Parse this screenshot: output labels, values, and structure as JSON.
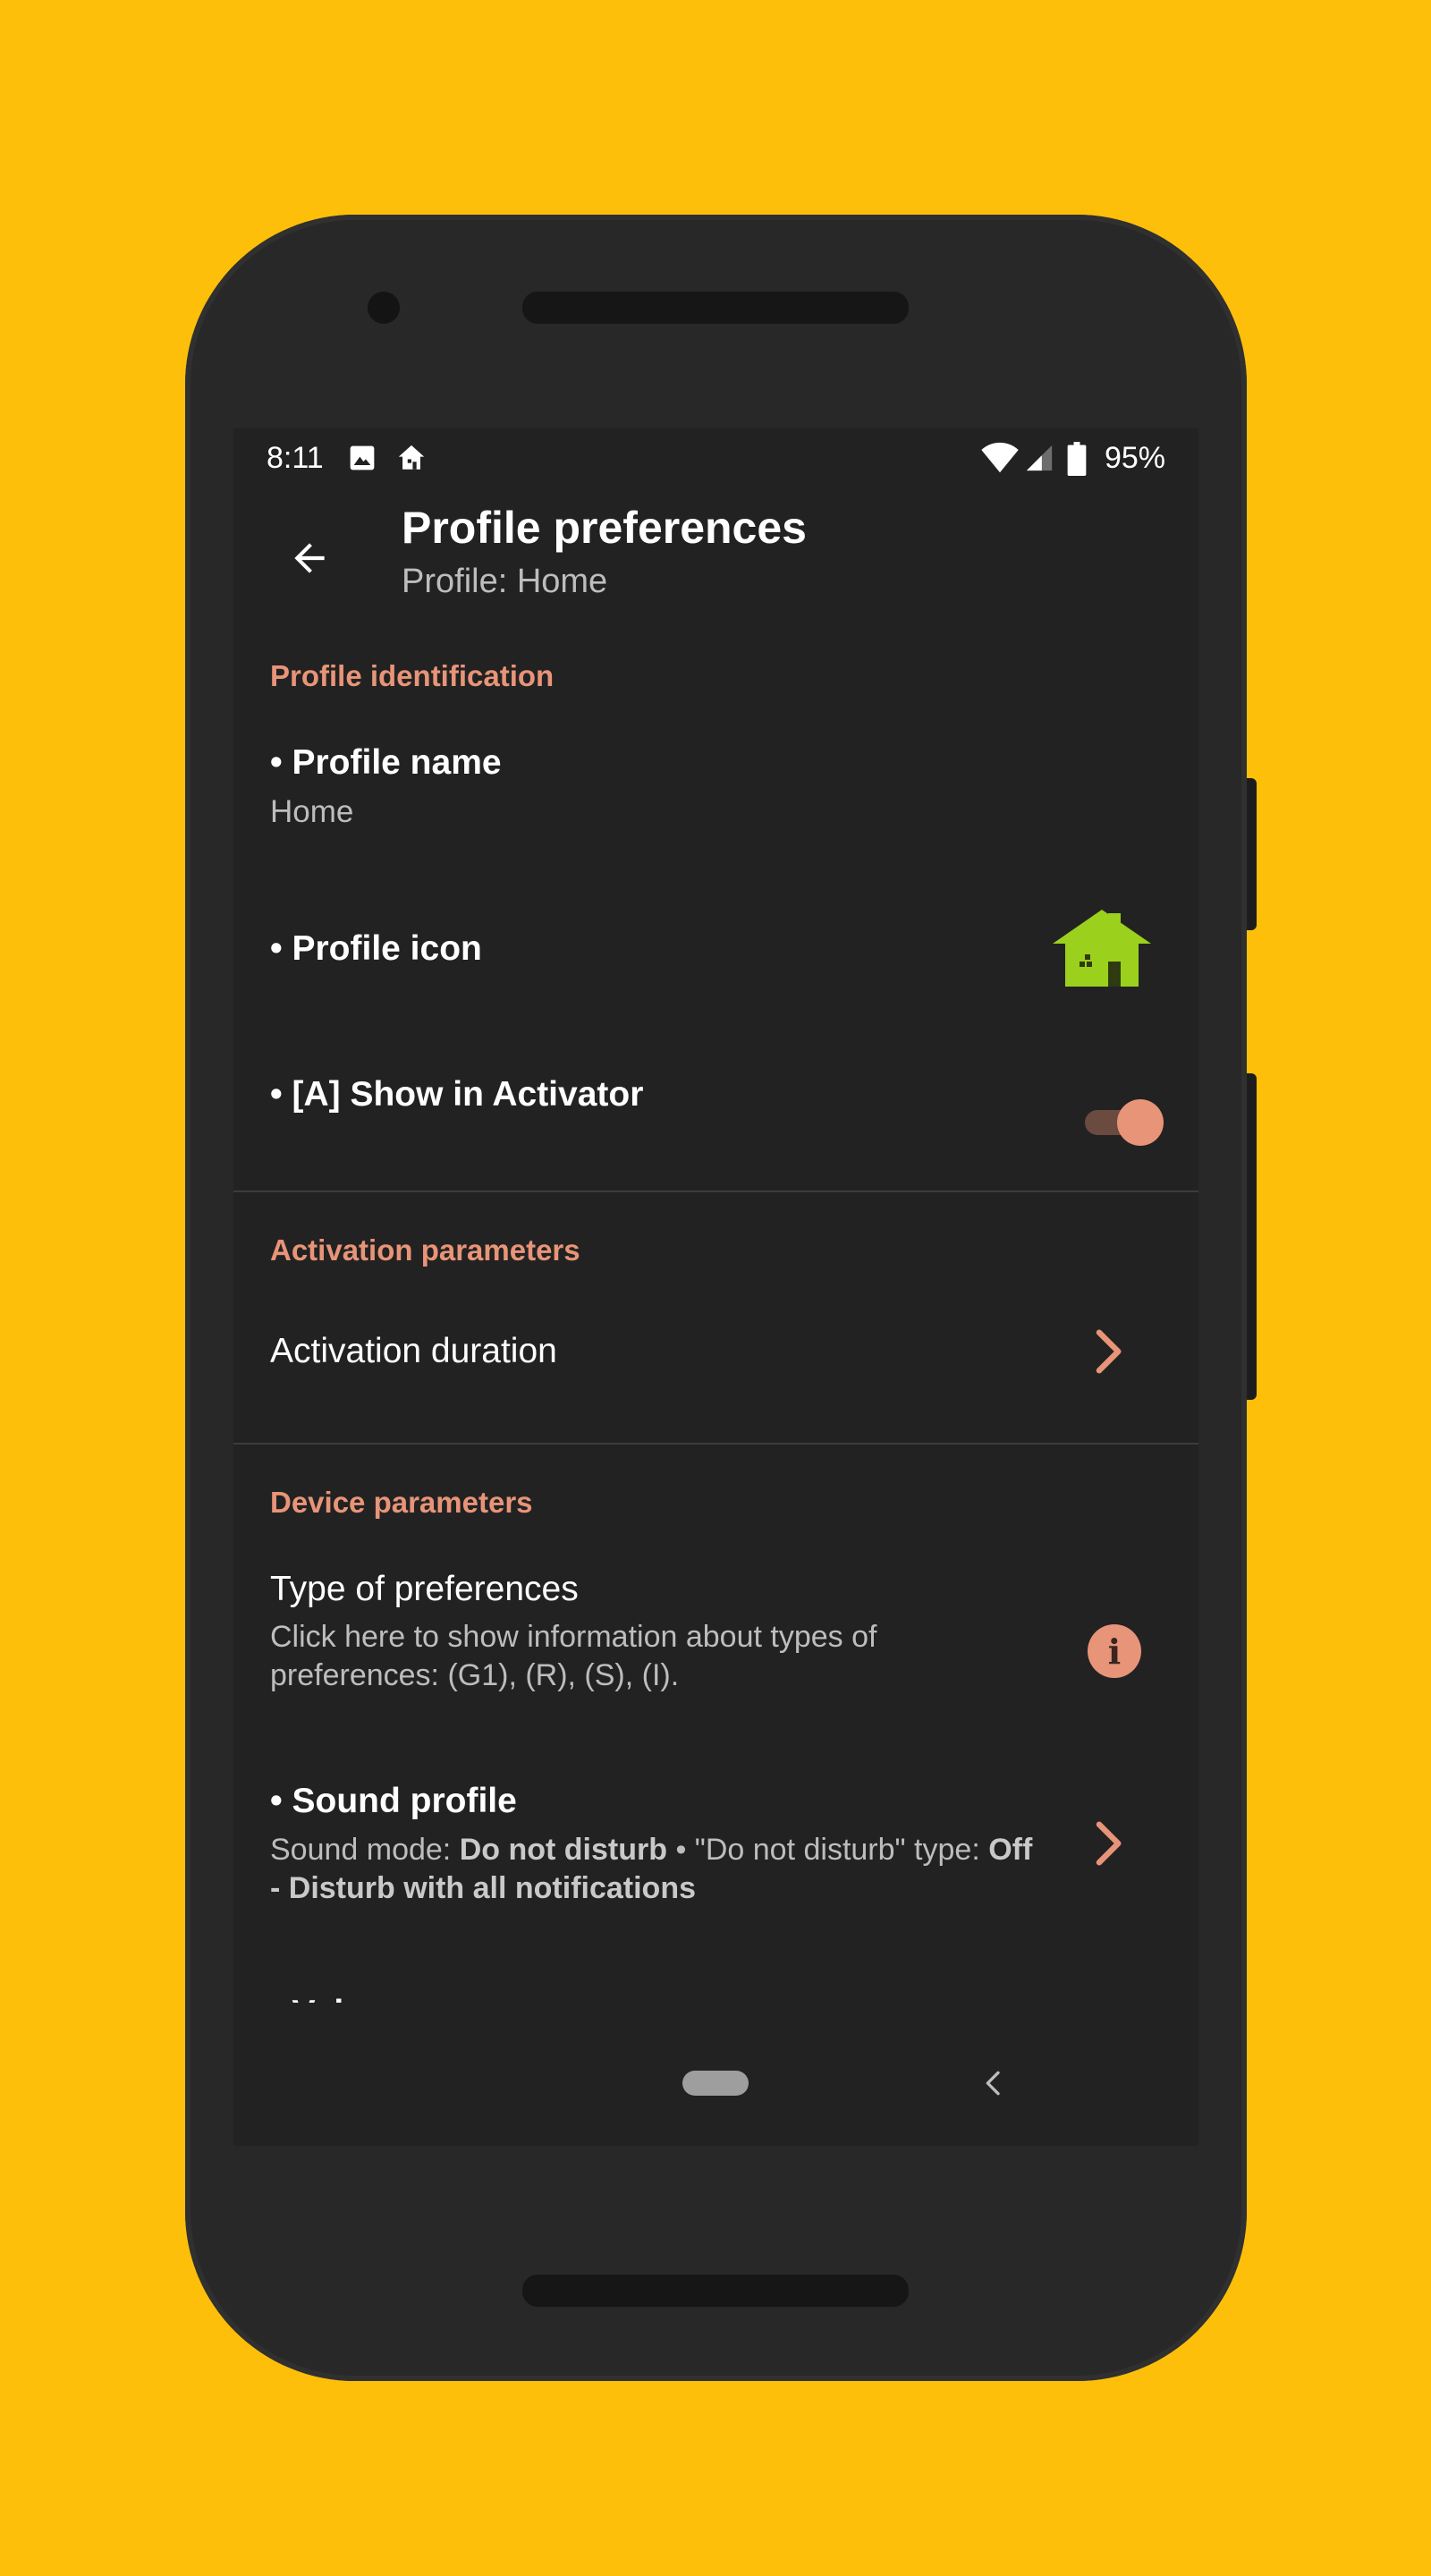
{
  "status_bar": {
    "time": "8:11",
    "battery": "95%",
    "icons": [
      "image-icon",
      "home-icon",
      "wifi-icon",
      "cell-signal-icon",
      "battery-icon"
    ]
  },
  "app_bar": {
    "title": "Profile preferences",
    "subtitle": "Profile: Home"
  },
  "sections": {
    "identification": {
      "header": "Profile identification",
      "profile_name_title": "• Profile name",
      "profile_name_value": "Home",
      "profile_icon_title": "• Profile icon",
      "show_in_activator_title": "• [A] Show in Activator",
      "show_in_activator_on": true
    },
    "activation": {
      "header": "Activation parameters",
      "duration_title": "Activation duration"
    },
    "device": {
      "header": "Device parameters",
      "type_title": "Type of preferences",
      "type_summary": "Click here to show information about types of preferences: (G1), (R), (S), (I).",
      "sound_title": "• Sound profile",
      "sound_summary_prefix": "Sound mode: ",
      "sound_mode": "Do not disturb",
      "sound_summary_mid": " • \"Do not disturb\" type: ",
      "dnd_type": "Off - Disturb with all notifications",
      "volumes_title": "• Volumes"
    }
  },
  "colors": {
    "background": "#FDBF0A",
    "accent": "#E89478",
    "screen": "#222222",
    "profile_icon": "#9BD11D"
  }
}
